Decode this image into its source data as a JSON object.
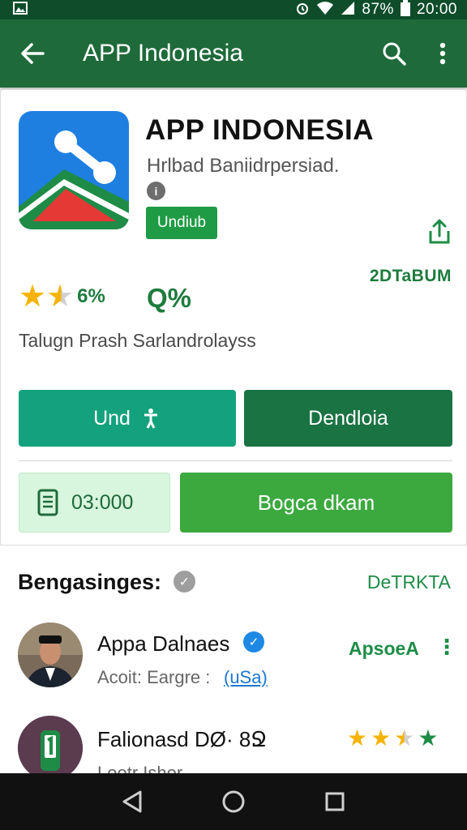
{
  "status_bar": {
    "battery_text": "87%",
    "time": "20:00"
  },
  "app_bar": {
    "title": "APP Indonesia",
    "icons": [
      "back-arrow-icon",
      "search-icon",
      "more-vert-icon"
    ]
  },
  "app": {
    "name": "APP INDONESIA",
    "developer": "Hrlbad Baniidrpersiad.",
    "badge": "Undiub",
    "downloads": "2DTaBUM",
    "rating": "6%",
    "percent": "Q%",
    "description": "Talugn Prash Sarlandrolayss",
    "icon_colors": {
      "blue": "#1e7fe0",
      "green": "#1e8c47",
      "red": "#e53935"
    }
  },
  "buttons": {
    "install": "Und",
    "download": "Dendloia",
    "size": "03:000",
    "open": "Bogca dkam"
  },
  "reviews": {
    "section_title": "Bengasinges:",
    "section_link": "DeTRKTA",
    "items": [
      {
        "name": "Appa Dalnaes",
        "sub": "Acoit: Eargre :",
        "sub_link": "(uSa)",
        "action": "ApsoeA",
        "more": "⋮"
      },
      {
        "name": "Falionasd DØ· 8Ջ",
        "sub": "Lootr  Ishor"
      }
    ]
  },
  "colors": {
    "status_bar": "#0f4d2a",
    "app_bar": "#1e6a3a",
    "accent_green": "#1e8c47",
    "teal_button": "#13a27d",
    "dark_green_button": "#1a7343",
    "light_green_button": "#3ca93f"
  }
}
